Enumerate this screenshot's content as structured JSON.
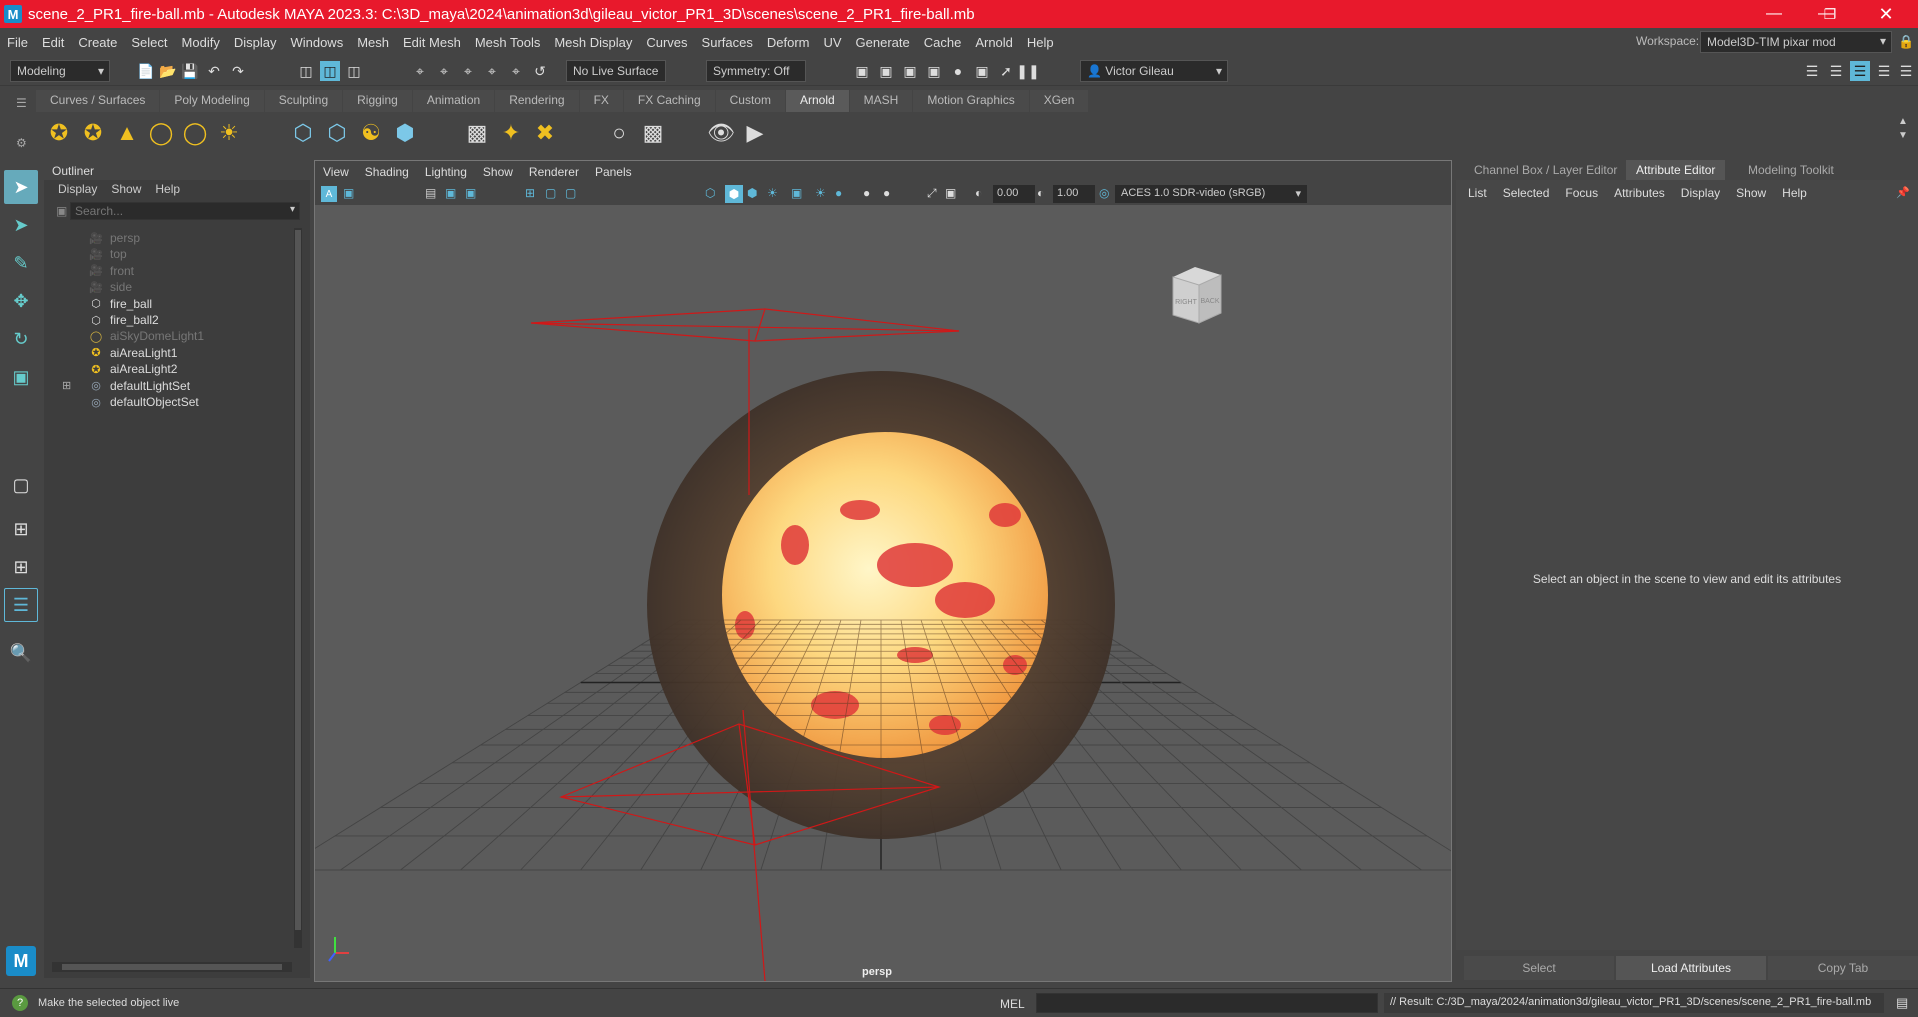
{
  "window": {
    "title": "scene_2_PR1_fire-ball.mb - Autodesk MAYA 2023.3: C:\\3D_maya\\2024\\animation3d\\gileau_victor_PR1_3D\\scenes\\scene_2_PR1_fire-ball.mb",
    "logo": "M"
  },
  "menu": [
    "File",
    "Edit",
    "Create",
    "Select",
    "Modify",
    "Display",
    "Windows",
    "Mesh",
    "Edit Mesh",
    "Mesh Tools",
    "Mesh Display",
    "Curves",
    "Surfaces",
    "Deform",
    "UV",
    "Generate",
    "Cache",
    "Arnold",
    "Help"
  ],
  "workspace": {
    "label": "Workspace:",
    "value": "Model3D-TIM pixar mod"
  },
  "status": {
    "mode": "Modeling",
    "live_surface": "No Live Surface",
    "symmetry": "Symmetry: Off",
    "user": "Victor Gileau"
  },
  "shelf_tabs": [
    "Curves / Surfaces",
    "Poly Modeling",
    "Sculpting",
    "Rigging",
    "Animation",
    "Rendering",
    "FX",
    "FX Caching",
    "Custom",
    "Arnold",
    "MASH",
    "Motion Graphics",
    "XGen"
  ],
  "shelf_active": "Arnold",
  "outliner": {
    "title": "Outliner",
    "menu": [
      "Display",
      "Show",
      "Help"
    ],
    "search_placeholder": "Search...",
    "items": [
      {
        "label": "persp",
        "icon": "camera-icon",
        "dim": true
      },
      {
        "label": "top",
        "icon": "camera-icon",
        "dim": true
      },
      {
        "label": "front",
        "icon": "camera-icon",
        "dim": true
      },
      {
        "label": "side",
        "icon": "camera-icon",
        "dim": true
      },
      {
        "label": "fire_ball",
        "icon": "mesh-icon",
        "dim": false
      },
      {
        "label": "fire_ball2",
        "icon": "mesh-icon",
        "dim": false
      },
      {
        "label": "aiSkyDomeLight1",
        "icon": "skydome-icon",
        "dim": true
      },
      {
        "label": "aiAreaLight1",
        "icon": "area-light-icon",
        "dim": false
      },
      {
        "label": "aiAreaLight2",
        "icon": "area-light-icon",
        "dim": false
      },
      {
        "label": "defaultLightSet",
        "icon": "set-icon",
        "dim": false
      },
      {
        "label": "defaultObjectSet",
        "icon": "set-icon",
        "dim": false
      }
    ]
  },
  "viewport": {
    "menu": [
      "View",
      "Shading",
      "Lighting",
      "Show",
      "Renderer",
      "Panels"
    ],
    "exposure": "0.00",
    "gamma": "1.00",
    "colorspace": "ACES 1.0 SDR-video (sRGB)",
    "camera": "persp",
    "cube_right": "RIGHT",
    "cube_back": "BACK"
  },
  "attr": {
    "tabs": [
      "Channel Box / Layer Editor",
      "Attribute Editor",
      "Modeling Toolkit"
    ],
    "menu": [
      "List",
      "Selected",
      "Focus",
      "Attributes",
      "Display",
      "Show",
      "Help"
    ],
    "message": "Select an object in the scene to view and edit its attributes",
    "buttons": [
      "Select",
      "Load Attributes",
      "Copy Tab"
    ]
  },
  "bottom": {
    "help": "Make the selected object live",
    "mel": "MEL",
    "result": "// Result: C:/3D_maya/2024/animation3d/gileau_victor_PR1_3D/scenes/scene_2_PR1_fire-ball.mb"
  },
  "colors": {
    "titlebar": "#e8192c",
    "accent": "#5fb8d8",
    "light_wire": "#d01818"
  }
}
